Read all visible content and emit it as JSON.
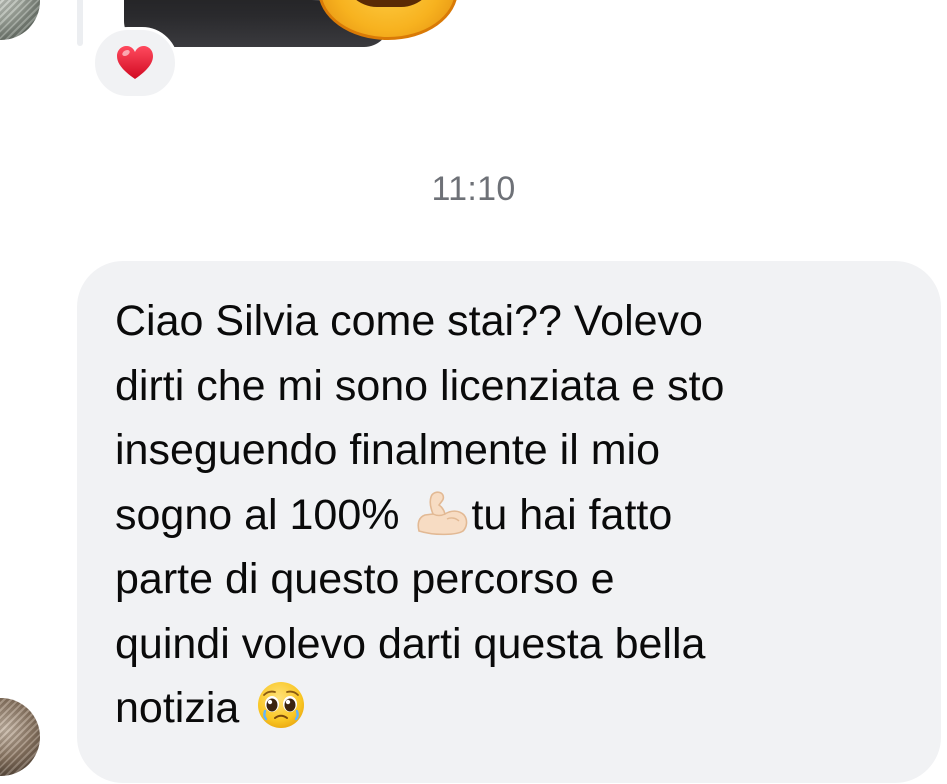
{
  "thread": {
    "previous_message": {
      "media_type": "photo",
      "reaction": {
        "icon": "red-heart-icon",
        "color": "#e0112b"
      }
    },
    "timestamp": "11:10",
    "message": {
      "lines": [
        "Ciao Silvia come stai?? Volevo",
        "dirti che mi sono licenziata e sto",
        "inseguendo finalmente il mio",
        "sogno al 100%",
        "tu hai fatto",
        "parte di questo percorso e",
        "quindi volevo darti questa bella",
        "notizia"
      ],
      "emojis": {
        "after_line_4": "flexed-biceps-icon",
        "after_line_8": "pleading-face-icon"
      },
      "bubble_color": "#f1f2f4",
      "text_color": "#0a0a0a"
    }
  },
  "colors": {
    "timestamp": "#6e7177",
    "background": "#ffffff"
  }
}
